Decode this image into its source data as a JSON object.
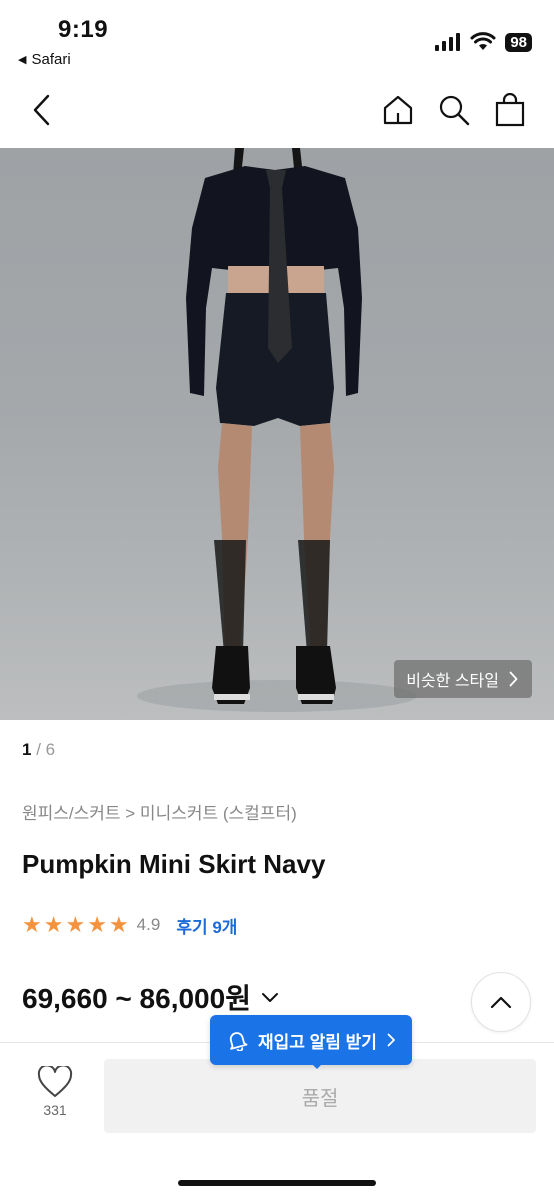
{
  "status_bar": {
    "time": "9:19",
    "back_app": "Safari",
    "battery": "98"
  },
  "nav": {
    "icons": [
      "back-chevron-icon",
      "home-icon",
      "search-icon",
      "shopping-bag-icon"
    ]
  },
  "photo": {
    "similar_style_label": "비슷한 스타일"
  },
  "pager": {
    "current": "1",
    "separator": "/",
    "total": "6"
  },
  "product": {
    "breadcrumb": "원피스/스커트 > 미니스커트 (스컬프터)",
    "title": "Pumpkin Mini Skirt Navy",
    "rating": 4.9,
    "rating_label": "4.9",
    "stars_filled": 5,
    "reviews_label": "후기 9개",
    "price": "69,660 ~ 86,000원"
  },
  "bottom": {
    "like_count": "331",
    "soldout_label": "품절",
    "restock_label": "재입고 알림 받기"
  },
  "colors": {
    "accent_blue": "#1b73e8",
    "review_link": "#1c6cd8",
    "star": "#f5923e",
    "soldout_bg": "#f1f1f1"
  }
}
